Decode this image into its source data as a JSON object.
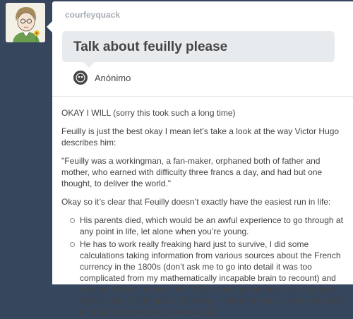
{
  "post": {
    "blog_name": "courfeyquack",
    "question": "Talk about feuilly please",
    "asker_name": "Anónimo",
    "answer": {
      "paragraphs": [
        "OKAY I WILL (sorry this took such a long time)",
        "Feuilly is just the best okay I mean let’s take a look at the way Victor Hugo describes him:",
        "\"Feuilly was a workingman, a fan-maker, orphaned both of father and mother, who earned with difficulty three francs a day, and had but one thought, to deliver the world.\"",
        "Okay so it’s clear that Feuilly doesn’t exactly have the easiest run in life:"
      ],
      "bullets": [
        "His parents died, which would be an awful experience to go through at any point in life, let alone when you’re young.",
        "He has to work really freaking hard just to survive, I did some calculations taking information from various sources about the French currency in the 1800s (don’t ask me to go into detail it was too complicated from my mathematically incapable brain to recount) and earning 3 francs a day in the 1830s would be equal to earning about €8.50 a day (£7.30 or $11.30) today. In short he had to work very hard in order to earn not very much at all."
      ]
    }
  },
  "colors": {
    "dashboard_bg": "#36465d",
    "post_bg": "#ffffff",
    "question_bg": "#e8ebee",
    "blog_name": "#a7adb4",
    "text": "#444444"
  },
  "icons": {
    "avatar": "user-avatar-icon",
    "asker": "anonymous-icon"
  }
}
